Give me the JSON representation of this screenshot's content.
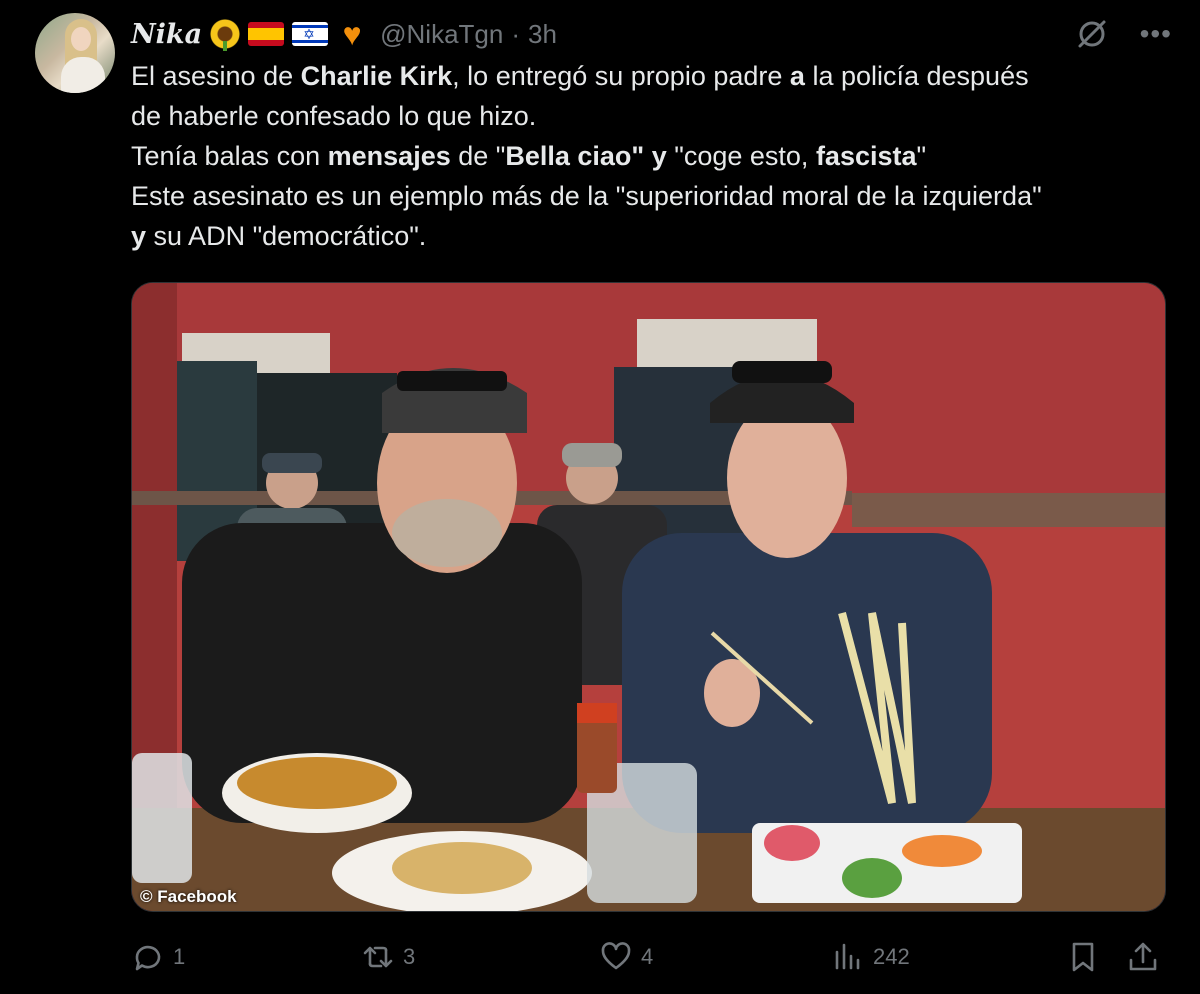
{
  "tweet": {
    "name": "Nika",
    "handle": "@NikaTgn",
    "separator": "·",
    "time": "3h",
    "emojis": [
      "sunflower-emoji",
      "spain-flag-emoji",
      "israel-flag-emoji",
      "orange-heart-emoji"
    ],
    "text": {
      "line1_a": "El asesino de ",
      "line1_b": "Charlie Kirk",
      "line1_c": ", lo entregó su propio padre ",
      "line1_d": "a",
      "line1_e": " la policía después",
      "line2": "de haberle confesado lo que hizo.",
      "line3_a": "Tenía balas con ",
      "line3_b": "mensajes",
      "line3_c": " de \"",
      "line3_d": "Bella ciao\" y",
      "line3_e": " \"coge esto, ",
      "line3_f": "fascista",
      "line3_g": "\"",
      "line4": "Este asesinato es un ejemplo más de la \"superioridad moral de la izquierda\"",
      "line5_a": "y",
      "line5_b": " su ADN \"democrático\"."
    },
    "media": {
      "credit": "© Facebook",
      "description_icon": "photo"
    },
    "actions": {
      "replies": "1",
      "retweets": "3",
      "likes": "4",
      "views": "242"
    },
    "colors": {
      "background": "#000000",
      "text": "#e7e9ea",
      "secondary": "#71767b"
    }
  }
}
